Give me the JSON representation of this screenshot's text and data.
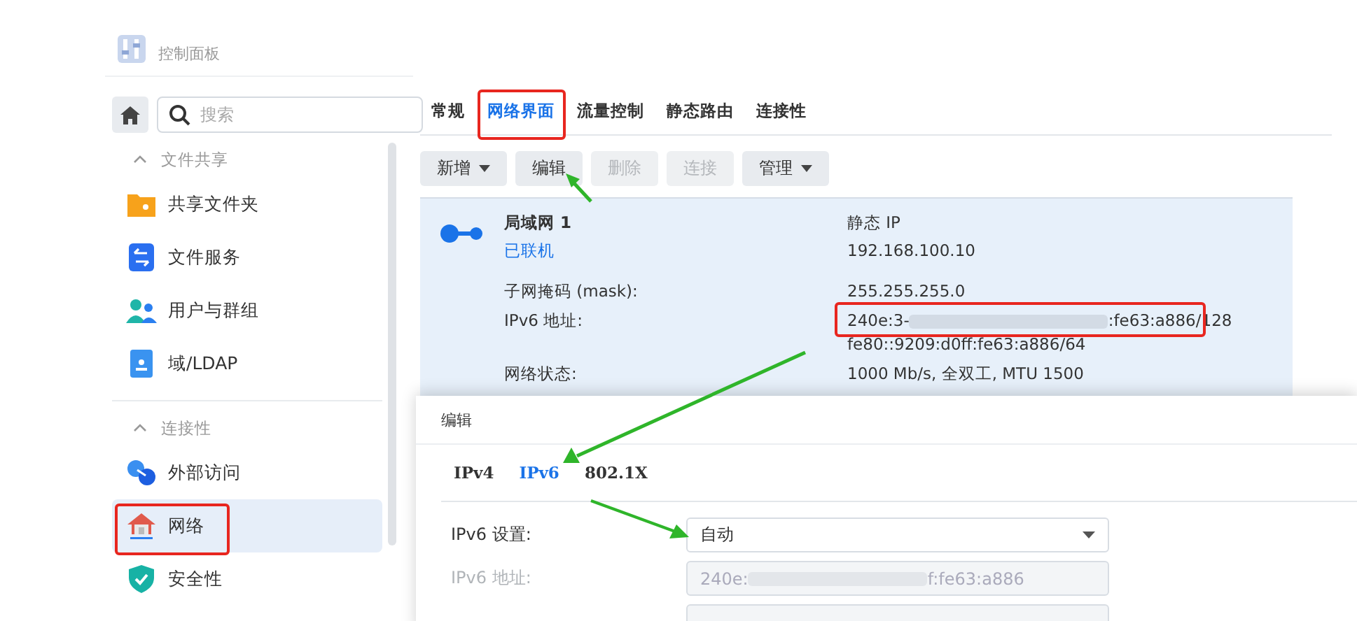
{
  "window": {
    "title": "控制面板"
  },
  "sidebar": {
    "search": {
      "placeholder": "搜索"
    },
    "sections": [
      {
        "title": "文件共享",
        "expanded": true,
        "items": [
          {
            "label": "共享文件夹",
            "kind": "folder",
            "selected": false
          },
          {
            "label": "文件服务",
            "kind": "transfer",
            "selected": false
          },
          {
            "label": "用户与群组",
            "kind": "users",
            "selected": false
          },
          {
            "label": "域/LDAP",
            "kind": "card",
            "selected": false
          }
        ]
      },
      {
        "title": "连接性",
        "expanded": true,
        "items": [
          {
            "label": "外部访问",
            "kind": "link",
            "selected": false
          },
          {
            "label": "网络",
            "kind": "house",
            "selected": true
          },
          {
            "label": "安全性",
            "kind": "shield",
            "selected": false
          }
        ]
      }
    ]
  },
  "tabs": [
    {
      "label": "常规",
      "selected": false
    },
    {
      "label": "网络界面",
      "selected": true
    },
    {
      "label": "流量控制",
      "selected": false
    },
    {
      "label": "静态路由",
      "selected": false
    },
    {
      "label": "连接性",
      "selected": false
    }
  ],
  "toolbar": [
    {
      "label": "新增",
      "dropdown": true,
      "disabled": false
    },
    {
      "label": "编辑",
      "dropdown": false,
      "disabled": false
    },
    {
      "label": "删除",
      "dropdown": false,
      "disabled": true
    },
    {
      "label": "连接",
      "dropdown": false,
      "disabled": true
    },
    {
      "label": "管理",
      "dropdown": true,
      "disabled": false
    }
  ],
  "interface": {
    "name": "局域网 1",
    "status": "已联机",
    "type": "静态 IP",
    "ip": "192.168.100.10",
    "details": [
      {
        "label": "子网掩码 (mask):",
        "values": [
          "255.255.255.0"
        ]
      },
      {
        "label": "IPv6 地址:",
        "values": [
          "240e:3-",
          ":fe63:a886/128"
        ],
        "blurred": true,
        "extra": "fe80::9209:d0ff:fe63:a886/64"
      },
      {
        "label": "网络状态:",
        "values": [
          "1000 Mb/s, 全双工, MTU 1500"
        ]
      }
    ]
  },
  "dialog": {
    "title": "编辑",
    "tabs": [
      {
        "label": "IPv4",
        "selected": false
      },
      {
        "label": "IPv6",
        "selected": true
      },
      {
        "label": "802.1X",
        "selected": false
      }
    ],
    "fields": [
      {
        "label": "IPv6 设置:",
        "kind": "select",
        "value": "自动",
        "disabled": false
      },
      {
        "label": "IPv6 地址:",
        "kind": "text",
        "value": [
          "240e:",
          "f:fe63:a886"
        ],
        "disabled": true
      }
    ]
  }
}
